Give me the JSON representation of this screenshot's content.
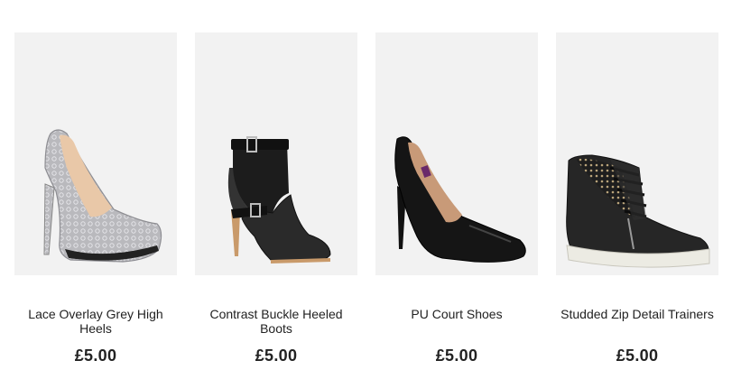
{
  "products": [
    {
      "name": "Lace Overlay Grey High Heels",
      "price": "£5.00",
      "image": "grey-lace-heel-icon"
    },
    {
      "name": "Contrast Buckle Heeled Boots",
      "price": "£5.00",
      "image": "buckle-boot-icon"
    },
    {
      "name": "PU Court Shoes",
      "price": "£5.00",
      "image": "black-court-shoe-icon"
    },
    {
      "name": "Studded Zip Detail Trainers",
      "price": "£5.00",
      "image": "studded-trainer-icon"
    }
  ]
}
